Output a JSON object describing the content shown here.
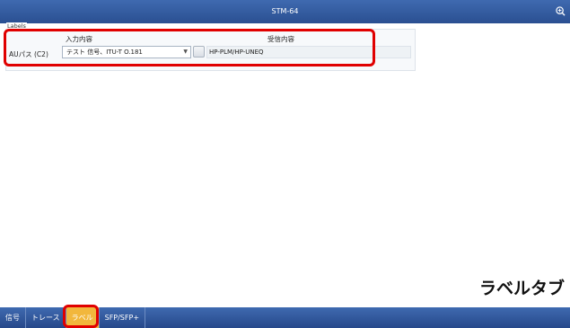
{
  "window": {
    "title": "STM-64"
  },
  "labels_panel": {
    "title": "Labels",
    "column_input": "入力内容",
    "column_received": "受信内容",
    "row_label": "AUパス (C2)",
    "input_value": "テスト 信号、ITU-T O.181",
    "received_value": "HP-PLM/HP-UNEQ"
  },
  "callout": "ラベルタブ",
  "tabs": [
    {
      "label": "信号",
      "active": false
    },
    {
      "label": "トレース",
      "active": false
    },
    {
      "label": "ラベル",
      "active": true
    },
    {
      "label": "SFP/SFP+",
      "active": false
    }
  ],
  "icons": {
    "zoom": "zoom-in-icon",
    "dropdown": "chevron-down-icon"
  },
  "colors": {
    "titlebar": "#2f5aa0",
    "active_tab": "#f2b73c",
    "highlight": "#e00000"
  }
}
